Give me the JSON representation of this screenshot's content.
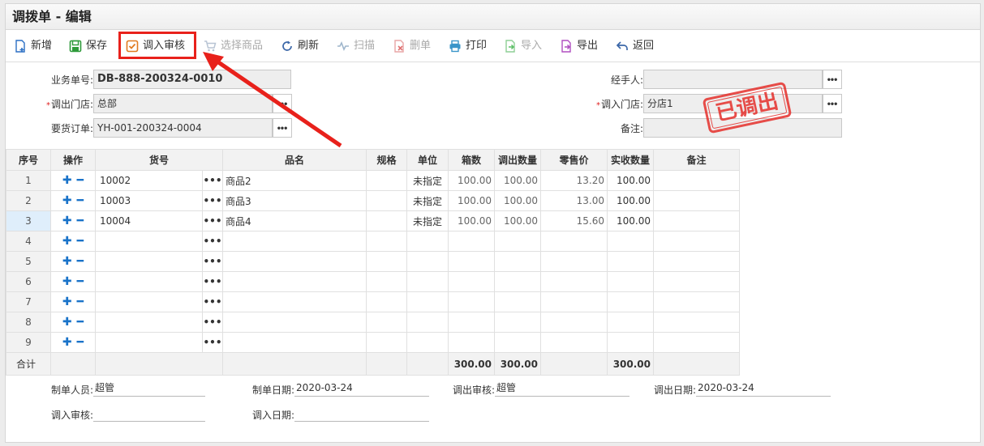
{
  "title": "调拨单 - 编辑",
  "toolbar": {
    "new": "新增",
    "save": "保存",
    "audit_in": "调入审核",
    "select_goods": "选择商品",
    "refresh": "刷新",
    "scan": "扫描",
    "delete": "删单",
    "print": "打印",
    "import": "导入",
    "export": "导出",
    "back": "返回"
  },
  "form": {
    "doc_no_label": "业务单号:",
    "doc_no": "DB-888-200324-0010",
    "out_store_label": "调出门店:",
    "out_store": "总部",
    "order_label": "要货订单:",
    "order": "YH-001-200324-0004",
    "handler_label": "经手人:",
    "handler": "",
    "in_store_label": "调入门店:",
    "in_store": "分店1",
    "remark_label": "备注:",
    "remark": ""
  },
  "stamp": "已调出",
  "grid": {
    "headers": [
      "序号",
      "操作",
      "货号",
      "品名",
      "规格",
      "单位",
      "箱数",
      "调出数量",
      "零售价",
      "实收数量",
      "备注"
    ],
    "rows": [
      {
        "no": "1",
        "code": "10002",
        "name": "商品2",
        "spec": "",
        "unit": "未指定",
        "boxes": "100.00",
        "out_qty": "100.00",
        "price": "13.20",
        "recv_qty": "100.00",
        "remark": ""
      },
      {
        "no": "2",
        "code": "10003",
        "name": "商品3",
        "spec": "",
        "unit": "未指定",
        "boxes": "100.00",
        "out_qty": "100.00",
        "price": "13.00",
        "recv_qty": "100.00",
        "remark": ""
      },
      {
        "no": "3",
        "code": "10004",
        "name": "商品4",
        "spec": "",
        "unit": "未指定",
        "boxes": "100.00",
        "out_qty": "100.00",
        "price": "15.60",
        "recv_qty": "100.00",
        "remark": ""
      },
      {
        "no": "4",
        "code": "",
        "name": "",
        "spec": "",
        "unit": "",
        "boxes": "",
        "out_qty": "",
        "price": "",
        "recv_qty": "",
        "remark": ""
      },
      {
        "no": "5",
        "code": "",
        "name": "",
        "spec": "",
        "unit": "",
        "boxes": "",
        "out_qty": "",
        "price": "",
        "recv_qty": "",
        "remark": ""
      },
      {
        "no": "6",
        "code": "",
        "name": "",
        "spec": "",
        "unit": "",
        "boxes": "",
        "out_qty": "",
        "price": "",
        "recv_qty": "",
        "remark": ""
      },
      {
        "no": "7",
        "code": "",
        "name": "",
        "spec": "",
        "unit": "",
        "boxes": "",
        "out_qty": "",
        "price": "",
        "recv_qty": "",
        "remark": ""
      },
      {
        "no": "8",
        "code": "",
        "name": "",
        "spec": "",
        "unit": "",
        "boxes": "",
        "out_qty": "",
        "price": "",
        "recv_qty": "",
        "remark": ""
      },
      {
        "no": "9",
        "code": "",
        "name": "",
        "spec": "",
        "unit": "",
        "boxes": "",
        "out_qty": "",
        "price": "",
        "recv_qty": "",
        "remark": ""
      }
    ],
    "total_label": "合计",
    "total_boxes": "300.00",
    "total_out_qty": "300.00",
    "total_recv_qty": "300.00"
  },
  "footer": {
    "maker_label": "制单人员:",
    "maker": "超管",
    "make_date_label": "制单日期:",
    "make_date": "2020-03-24",
    "out_audit_label": "调出审核:",
    "out_audit": "超管",
    "out_date_label": "调出日期:",
    "out_date": "2020-03-24",
    "in_audit_label": "调入审核:",
    "in_audit": "",
    "in_date_label": "调入日期:",
    "in_date": ""
  },
  "colors": {
    "accent": "#1a73c9",
    "highlight": "#e8211b",
    "stamp": "#e5302c"
  }
}
